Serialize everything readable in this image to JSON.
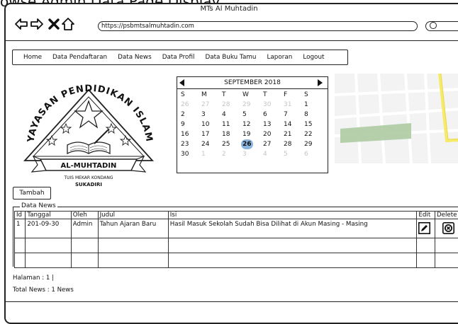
{
  "caption": "owse Admin Data Page Display",
  "window": {
    "title": "MTs Al Muhtadin"
  },
  "browser": {
    "url": "https://psbmtsalmuhtadin.com",
    "buttons": [
      "back-arrow-icon",
      "forward-arrow-icon",
      "close-x-icon",
      "home-icon"
    ]
  },
  "menu": {
    "items": [
      "Home",
      "Data Pendaftaran",
      "Data News",
      "Data Profil",
      "Data Buku Tamu",
      "Laporan",
      "Logout"
    ]
  },
  "logo": {
    "top_text": "PENDIDIKAN",
    "left_text": "YAYASAN",
    "right_text": "ISLAM",
    "banner": "AL-MUHTADIN",
    "sub1": "TUIS MEKAR KONDANG",
    "sub2": "SUKADIRI"
  },
  "calendar": {
    "month_label": "SEPTEMBER 2018",
    "weekdays": [
      "S",
      "M",
      "T",
      "W",
      "T",
      "F",
      "S"
    ],
    "weeks": [
      [
        [
          "26",
          true
        ],
        [
          "27",
          true
        ],
        [
          "28",
          true
        ],
        [
          "29",
          true
        ],
        [
          "30",
          true
        ],
        [
          "31",
          true
        ],
        [
          "1",
          false
        ]
      ],
      [
        [
          "2",
          false
        ],
        [
          "3",
          false
        ],
        [
          "4",
          false
        ],
        [
          "5",
          false
        ],
        [
          "6",
          false
        ],
        [
          "7",
          false
        ],
        [
          "8",
          false
        ]
      ],
      [
        [
          "9",
          false
        ],
        [
          "10",
          false
        ],
        [
          "11",
          false
        ],
        [
          "12",
          false
        ],
        [
          "13",
          false
        ],
        [
          "14",
          false
        ],
        [
          "15",
          false
        ]
      ],
      [
        [
          "16",
          false
        ],
        [
          "17",
          false
        ],
        [
          "18",
          false
        ],
        [
          "19",
          false
        ],
        [
          "20",
          false
        ],
        [
          "21",
          false
        ],
        [
          "22",
          false
        ]
      ],
      [
        [
          "23",
          false
        ],
        [
          "24",
          false
        ],
        [
          "25",
          false
        ],
        [
          "26",
          false
        ],
        [
          "27",
          false
        ],
        [
          "28",
          false
        ],
        [
          "29",
          false
        ]
      ],
      [
        [
          "30",
          false
        ],
        [
          "1",
          true
        ],
        [
          "2",
          true
        ],
        [
          "3",
          true
        ],
        [
          "4",
          true
        ],
        [
          "5",
          true
        ],
        [
          "6",
          true
        ]
      ]
    ],
    "selected_day": "26",
    "colors": {
      "selected": "#8ab3dd"
    }
  },
  "map": {
    "colors": {
      "road_yellow": "#f5ea6a",
      "park_green": "#a8c89b"
    }
  },
  "actions": {
    "add_label": "Tambah"
  },
  "news": {
    "legend": "Data News",
    "columns": [
      "Id",
      "Tanggal",
      "Oleh",
      "Judul",
      "Isi",
      "Edit",
      "Delete"
    ],
    "rows": [
      {
        "id": "1",
        "tanggal": "201-09-30",
        "oleh": "Admin",
        "judul": "Tahun Ajaran Baru",
        "isi": "Hasil  Masuk Sekolah Sudah Bisa Dilihat di Akun Masing - Masing"
      }
    ],
    "edit_icon": "edit-pencil-icon",
    "delete_icon": "delete-x-icon"
  },
  "footer": {
    "halaman": "Halaman : 1 |",
    "total": "Total News : 1 News"
  }
}
